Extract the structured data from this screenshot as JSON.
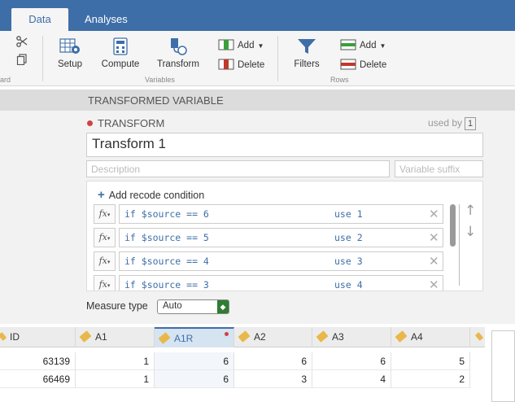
{
  "tabs": [
    {
      "label": "Data"
    },
    {
      "label": "Analyses"
    }
  ],
  "toolbar": {
    "clipboard_partial_label": "ard",
    "setup_label": "Setup",
    "compute_label": "Compute",
    "transform_label": "Transform",
    "variables_group": "Variables",
    "var_add_label": "Add",
    "var_delete_label": "Delete",
    "filters_label": "Filters",
    "row_add_label": "Add",
    "row_delete_label": "Delete",
    "rows_group": "Rows"
  },
  "section_title": "TRANSFORMED VARIABLE",
  "transform": {
    "label": "TRANSFORM",
    "used_by_label": "used by",
    "used_by_count": "1",
    "name": "Transform 1",
    "description_placeholder": "Description",
    "suffix_placeholder": "Variable suffix",
    "add_condition_label": "Add recode condition",
    "fx_label": "fx",
    "conditions": [
      {
        "expr": "if $source == 6",
        "use": "use 1"
      },
      {
        "expr": "if $source == 5",
        "use": "use 2"
      },
      {
        "expr": "if $source == 4",
        "use": "use 3"
      },
      {
        "expr": "if $source == 3",
        "use": "use 4"
      }
    ],
    "measure_type_label": "Measure type",
    "measure_type_value": "Auto"
  },
  "grid": {
    "columns": [
      "ID",
      "A1",
      "A1R",
      "A2",
      "A3",
      "A4"
    ],
    "rows": [
      [
        "63139",
        "1",
        "6",
        "6",
        "6",
        "5"
      ],
      [
        "66469",
        "1",
        "6",
        "3",
        "4",
        "2"
      ]
    ]
  },
  "colors": {
    "accent": "#3e6ea8",
    "dirty_marker": "#cc4444",
    "measure_chevron": "#2e7d32"
  },
  "icons": [
    "scissors-icon",
    "copy-icon",
    "setup-icon",
    "compute-icon",
    "transform-icon",
    "add-variable-icon",
    "delete-variable-icon",
    "filter-icon",
    "add-row-icon",
    "delete-row-icon",
    "nominal-tag-icon",
    "arrow-up-icon",
    "arrow-down-icon",
    "remove-icon"
  ]
}
